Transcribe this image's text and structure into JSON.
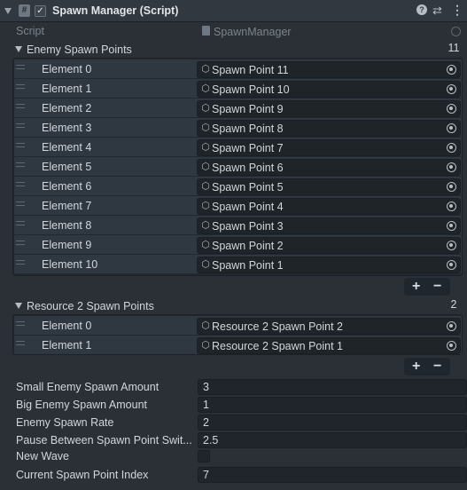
{
  "component": {
    "title": "Spawn Manager (Script)",
    "script_label": "Script",
    "script_value": "SpawnManager"
  },
  "enemy_spawn_points": {
    "label": "Enemy Spawn Points",
    "count": "11",
    "elements": [
      {
        "label": "Element 0",
        "value": "Spawn Point 11"
      },
      {
        "label": "Element 1",
        "value": "Spawn Point 10"
      },
      {
        "label": "Element 2",
        "value": "Spawn Point 9"
      },
      {
        "label": "Element 3",
        "value": "Spawn Point 8"
      },
      {
        "label": "Element 4",
        "value": "Spawn Point 7"
      },
      {
        "label": "Element 5",
        "value": "Spawn Point 6"
      },
      {
        "label": "Element 6",
        "value": "Spawn Point 5"
      },
      {
        "label": "Element 7",
        "value": "Spawn Point 4"
      },
      {
        "label": "Element 8",
        "value": "Spawn Point 3"
      },
      {
        "label": "Element 9",
        "value": "Spawn Point 2"
      },
      {
        "label": "Element 10",
        "value": "Spawn Point 1"
      }
    ]
  },
  "resource2_spawn_points": {
    "label": "Resource 2 Spawn Points",
    "count": "2",
    "elements": [
      {
        "label": "Element 0",
        "value": "Resource 2 Spawn Point 2"
      },
      {
        "label": "Element 1",
        "value": "Resource 2 Spawn Point 1"
      }
    ]
  },
  "list_controls": {
    "add": "+",
    "remove": "−"
  },
  "fields": [
    {
      "label": "Small Enemy Spawn Amount",
      "value": "3"
    },
    {
      "label": "Big Enemy Spawn Amount",
      "value": "1"
    },
    {
      "label": "Enemy Spawn Rate",
      "value": "2"
    },
    {
      "label": "Pause Between Spawn Point Swit...",
      "value": "2.5"
    },
    {
      "label": "New Wave",
      "value": ""
    },
    {
      "label": "Current Spawn Point Index",
      "value": "7"
    }
  ],
  "icons": {
    "header": [
      "expand-arrow-icon",
      "script-file-icon",
      "enabled-checkbox-icon",
      "help-icon",
      "preset-sliders-icon",
      "kebab-menu-icon"
    ],
    "object_field": [
      "gameobject-cube-icon",
      "object-picker-icon"
    ],
    "list": [
      "foldout-triangle-icon",
      "drag-handle-icon"
    ]
  },
  "colors": {
    "background": "#2b3036",
    "header": "#313840",
    "list_background": "#222830",
    "field_background": "#1f2429",
    "text": "#d2d6dc",
    "disabled_text": "#7d848c"
  }
}
